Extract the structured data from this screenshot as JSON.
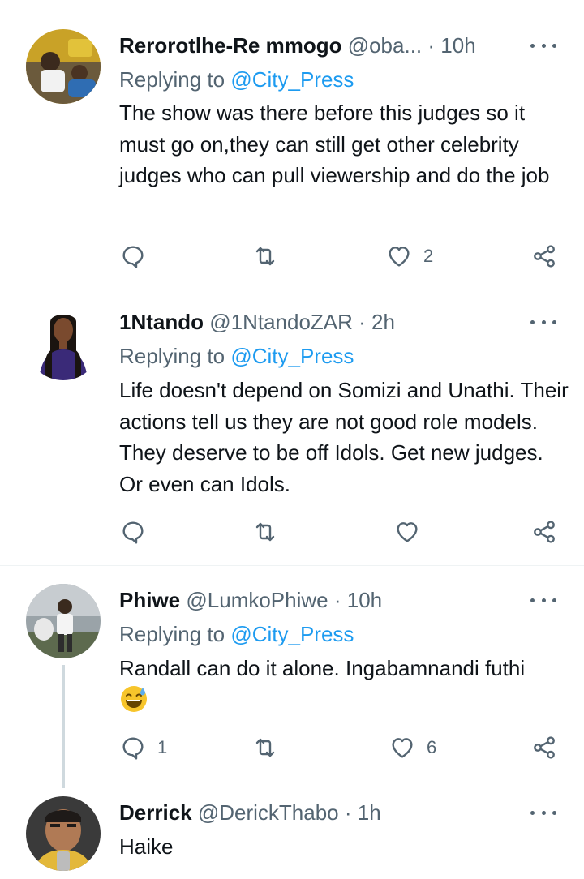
{
  "replies": [
    {
      "name": "Rerorotlhe-Re mmogo",
      "handle": "@oba...",
      "time": "· 10h",
      "replying_prefix": "Replying to ",
      "replying_to": "@City_Press",
      "text": "The show was there before this judges so it must go on,they can still get other celebrity judges who can pull viewership and do the job",
      "reply_count": "",
      "retweet_count": "",
      "like_count": "2"
    },
    {
      "name": "1Ntando",
      "handle": "@1NtandoZAR",
      "time": "· 2h",
      "replying_prefix": "Replying to ",
      "replying_to": "@City_Press",
      "text": "Life doesn't depend on Somizi and Unathi. Their actions tell us they are not good role models. They deserve to be off Idols. Get new judges. Or even can Idols.",
      "reply_count": "",
      "retweet_count": "",
      "like_count": ""
    },
    {
      "name": "Phiwe",
      "handle": "@LumkoPhiwe",
      "time": "· 10h",
      "replying_prefix": "Replying to ",
      "replying_to": "@City_Press",
      "text": "Randall can do it alone. Ingabamnandi futhi",
      "emoji": "sweat-smile-emoji",
      "reply_count": "1",
      "retweet_count": "",
      "like_count": "6"
    },
    {
      "name": "Derrick",
      "handle": "@DerickThabo",
      "time": "· 1h",
      "text": "Haike"
    }
  ],
  "colors": {
    "text": "#0f1419",
    "secondary": "#536471",
    "link": "#1d9bf0",
    "divider": "#eff3f4",
    "thread": "#cfd9de"
  },
  "icons": [
    "reply-icon",
    "retweet-icon",
    "like-icon",
    "share-icon",
    "more-icon"
  ]
}
